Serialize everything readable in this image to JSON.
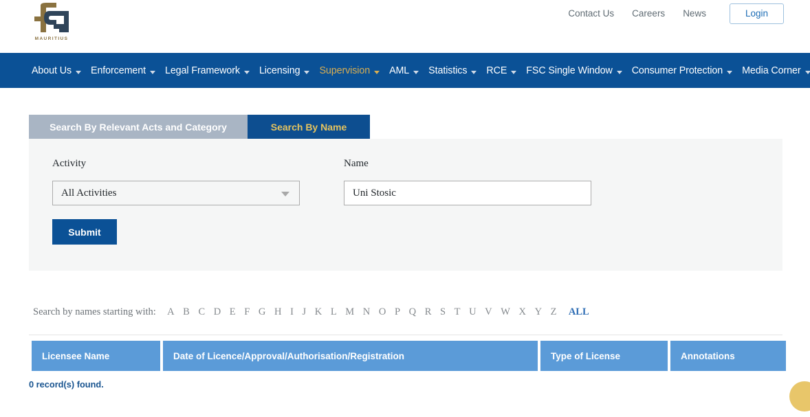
{
  "header": {
    "logo": {
      "icon": "fsc-logo-icon",
      "wordmark": "MAURITIUS"
    },
    "utility_links": [
      {
        "label": "Contact Us",
        "name": "contact-us"
      },
      {
        "label": "Careers",
        "name": "careers"
      },
      {
        "label": "News",
        "name": "news"
      }
    ],
    "login_label": "Login"
  },
  "nav": {
    "items": [
      {
        "label": "About Us",
        "active": false,
        "caret": true
      },
      {
        "label": "Enforcement",
        "active": false,
        "caret": true
      },
      {
        "label": "Legal Framework",
        "active": false,
        "caret": true
      },
      {
        "label": "Licensing",
        "active": false,
        "caret": true
      },
      {
        "label": "Supervision",
        "active": true,
        "caret": true
      },
      {
        "label": "AML",
        "active": false,
        "caret": true
      },
      {
        "label": "Statistics",
        "active": false,
        "caret": true
      },
      {
        "label": "RCE",
        "active": false,
        "caret": true
      },
      {
        "label": "FSC Single Window",
        "active": false,
        "caret": true
      },
      {
        "label": "Consumer Protection",
        "active": false,
        "caret": true
      },
      {
        "label": "Media Corner",
        "active": false,
        "caret": true
      }
    ]
  },
  "tabs": [
    {
      "label": "Search By Relevant Acts and Category",
      "active": false
    },
    {
      "label": "Search By Name",
      "active": true
    }
  ],
  "search_form": {
    "activity": {
      "label": "Activity",
      "selected": "All Activities",
      "caret_icon": "chevron-down-icon"
    },
    "name": {
      "label": "Name",
      "value": "Uni Stosic",
      "placeholder": ""
    },
    "submit_label": "Submit"
  },
  "alpha_filter": {
    "lead_text": "Search by names starting with:",
    "letters": [
      "A",
      "B",
      "C",
      "D",
      "E",
      "F",
      "G",
      "H",
      "I",
      "J",
      "K",
      "L",
      "M",
      "N",
      "O",
      "P",
      "Q",
      "R",
      "S",
      "T",
      "U",
      "V",
      "W",
      "X",
      "Y",
      "Z"
    ],
    "all_label": "ALL"
  },
  "results": {
    "columns": [
      "Licensee Name",
      "Date of Licence/Approval/Authorisation/Registration",
      "Type of License",
      "Annotations"
    ],
    "rows": [],
    "record_count_text": "0 record(s) found."
  },
  "floating": {
    "chat_bubble": "chat-bubble-icon"
  },
  "colors": {
    "nav_blue": "#0b5196",
    "active_nav_gold": "#d9ae52",
    "tab_active_bg": "#0d4e90",
    "tab_active_text": "#e5c35f",
    "tab_inactive_bg": "#a9b5c4",
    "table_header_blue": "#5b9bd8",
    "link_blue": "#2e6db4",
    "record_count_blue": "#17538f",
    "bubble_gold": "#e8c66a"
  }
}
